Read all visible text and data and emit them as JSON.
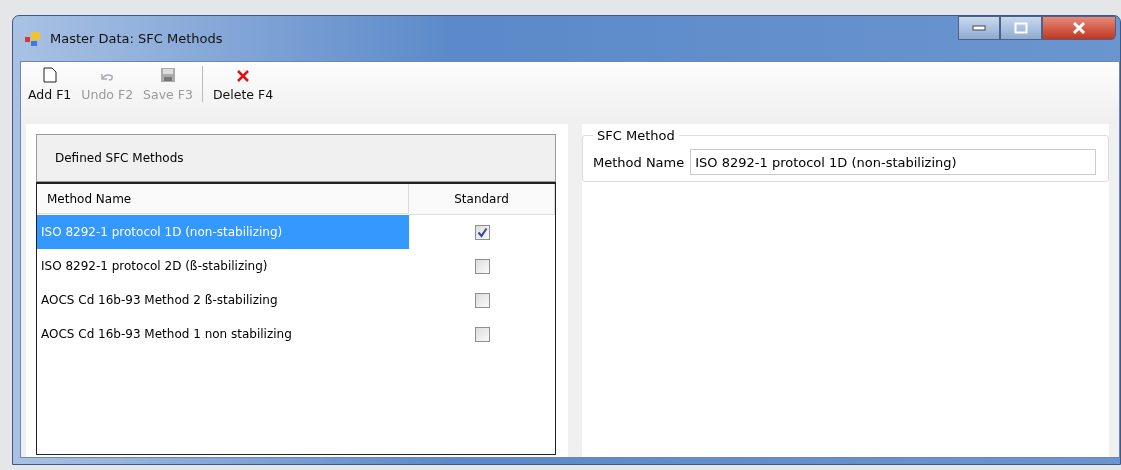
{
  "window": {
    "title": "Master Data: SFC Methods"
  },
  "toolbar": [
    {
      "kind": "new",
      "label": "Add F1",
      "disabled": false,
      "separator_before": false
    },
    {
      "kind": "undo",
      "label": "Undo F2",
      "disabled": true,
      "separator_before": false
    },
    {
      "kind": "save",
      "label": "Save F3",
      "disabled": true,
      "separator_before": false
    },
    {
      "kind": "delete",
      "label": "Delete F4",
      "disabled": false,
      "separator_before": true
    }
  ],
  "list_panel": {
    "title": "Defined SFC Methods",
    "columns": [
      "Method Name",
      "Standard"
    ],
    "rows": [
      {
        "name": "ISO 8292-1 protocol 1D (non-stabilizing)",
        "standard": true,
        "selected": true
      },
      {
        "name": "ISO 8292-1 protocol 2D (ß-stabilizing)",
        "standard": false,
        "selected": false
      },
      {
        "name": "AOCS Cd 16b-93 Method 2 ß-stabilizing",
        "standard": false,
        "selected": false
      },
      {
        "name": "AOCS Cd 16b-93 Method 1 non stabilizing",
        "standard": false,
        "selected": false
      }
    ]
  },
  "detail": {
    "group_title": "SFC Method",
    "field_label": "Method Name",
    "field_value": "ISO 8292-1 protocol 1D (non-stabilizing)"
  }
}
